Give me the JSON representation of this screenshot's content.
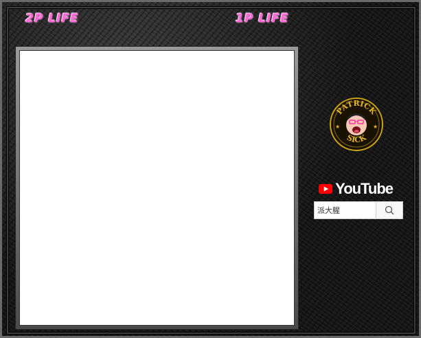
{
  "hud": {
    "p2_life_label": "2P LIFE",
    "p1_life_label": "1P LIFE"
  },
  "sidebar": {
    "logo_icon": "patrick-sick-emblem-icon",
    "youtube": {
      "wordmark": "YouTube",
      "search_value": "派大腥",
      "search_icon": "search-icon"
    }
  },
  "colors": {
    "life_text": "#ff6ad6",
    "play_area": "#ffffff",
    "youtube_red": "#ff0000"
  }
}
